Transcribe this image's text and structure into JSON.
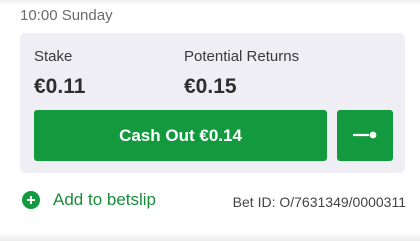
{
  "header": {
    "datetime": "10:00 Sunday"
  },
  "bet": {
    "stake_label": "Stake",
    "stake_value": "€0.11",
    "returns_label": "Potential Returns",
    "returns_value": "€0.15",
    "cashout_label": "Cash Out €0.14",
    "slider_icon": "partial-cashout-slider-icon",
    "add_to_betslip_label": "Add to betslip",
    "add_icon": "plus-circle-icon",
    "bet_id": "Bet ID: O/7631349/0000311"
  },
  "colors": {
    "accent_green": "#139a3f",
    "card_background": "#efeef5"
  }
}
